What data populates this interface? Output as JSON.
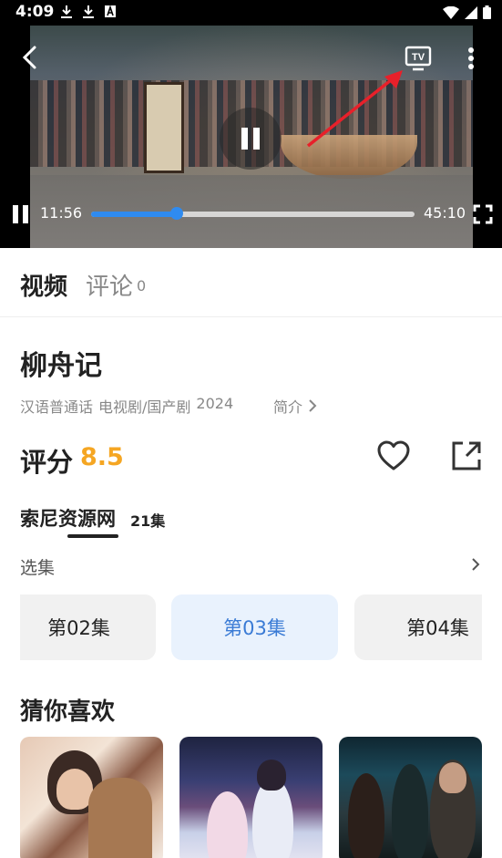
{
  "status_bar": {
    "time": "4:09",
    "left_icons": [
      "download-icon",
      "download-icon",
      "a-badge-icon"
    ],
    "right_icons": [
      "wifi-icon",
      "signal-icon",
      "battery-icon"
    ]
  },
  "player": {
    "current_time": "11:56",
    "total_time": "45:10",
    "progress": 0.264,
    "accent_color": "#2f8bf0",
    "tv_label": "TV"
  },
  "tabs": {
    "video": "视频",
    "comment": "评论",
    "comment_count": "0"
  },
  "show": {
    "title": "柳舟记",
    "language": "汉语普通话",
    "category": "电视剧/国产剧",
    "year": "2024",
    "intro_label": "简介",
    "score_label": "评分",
    "score": "8.5",
    "score_color": "#f5a623"
  },
  "source": {
    "name": "索尼资源网",
    "episodes_count": "21集"
  },
  "episodes": {
    "label": "选集",
    "items": [
      "第02集",
      "第03集",
      "第04集"
    ],
    "selected_index": 1
  },
  "recommend": {
    "title": "猜你喜欢"
  }
}
